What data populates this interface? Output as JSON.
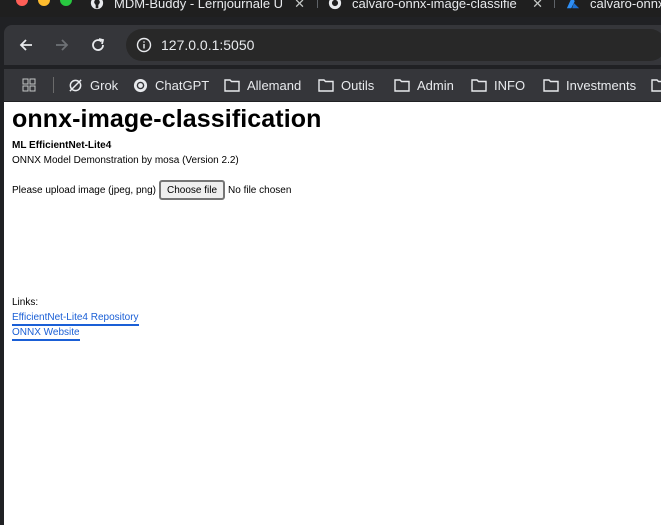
{
  "browser": {
    "tabs": [
      {
        "title": "MDM-Buddy - Lernjournale U",
        "close": "✕"
      },
      {
        "title": "calvaro-onnx-image-classifie",
        "close": "✕"
      },
      {
        "title": "calvaro-onnx"
      }
    ],
    "address": "127.0.0.1:5050",
    "bookmarks": [
      {
        "label": "Grok",
        "icon": "grok-icon"
      },
      {
        "label": "ChatGPT",
        "icon": "chatgpt-icon"
      },
      {
        "label": "Allemand",
        "icon": "folder-icon"
      },
      {
        "label": "Outils",
        "icon": "folder-icon"
      },
      {
        "label": "Admin",
        "icon": "folder-icon"
      },
      {
        "label": "INFO",
        "icon": "folder-icon"
      },
      {
        "label": "Investments",
        "icon": "folder-icon"
      }
    ]
  },
  "page": {
    "title": "onnx-image-classification",
    "subtitle": "ML EfficientNet-Lite4",
    "description": "ONNX Model Demonstration by mosa (Version 2.2)",
    "upload": {
      "label": "Please upload image (jpeg, png)",
      "button": "Choose file",
      "status": "No file chosen"
    },
    "links_label": "Links:",
    "links": [
      {
        "text": "EfficientNet-Lite4 Repository"
      },
      {
        "text": "ONNX Website"
      }
    ]
  },
  "colors": {
    "link": "#1a5fd6",
    "toolbar": "#35363a",
    "tabstrip": "#1f1f1f"
  }
}
